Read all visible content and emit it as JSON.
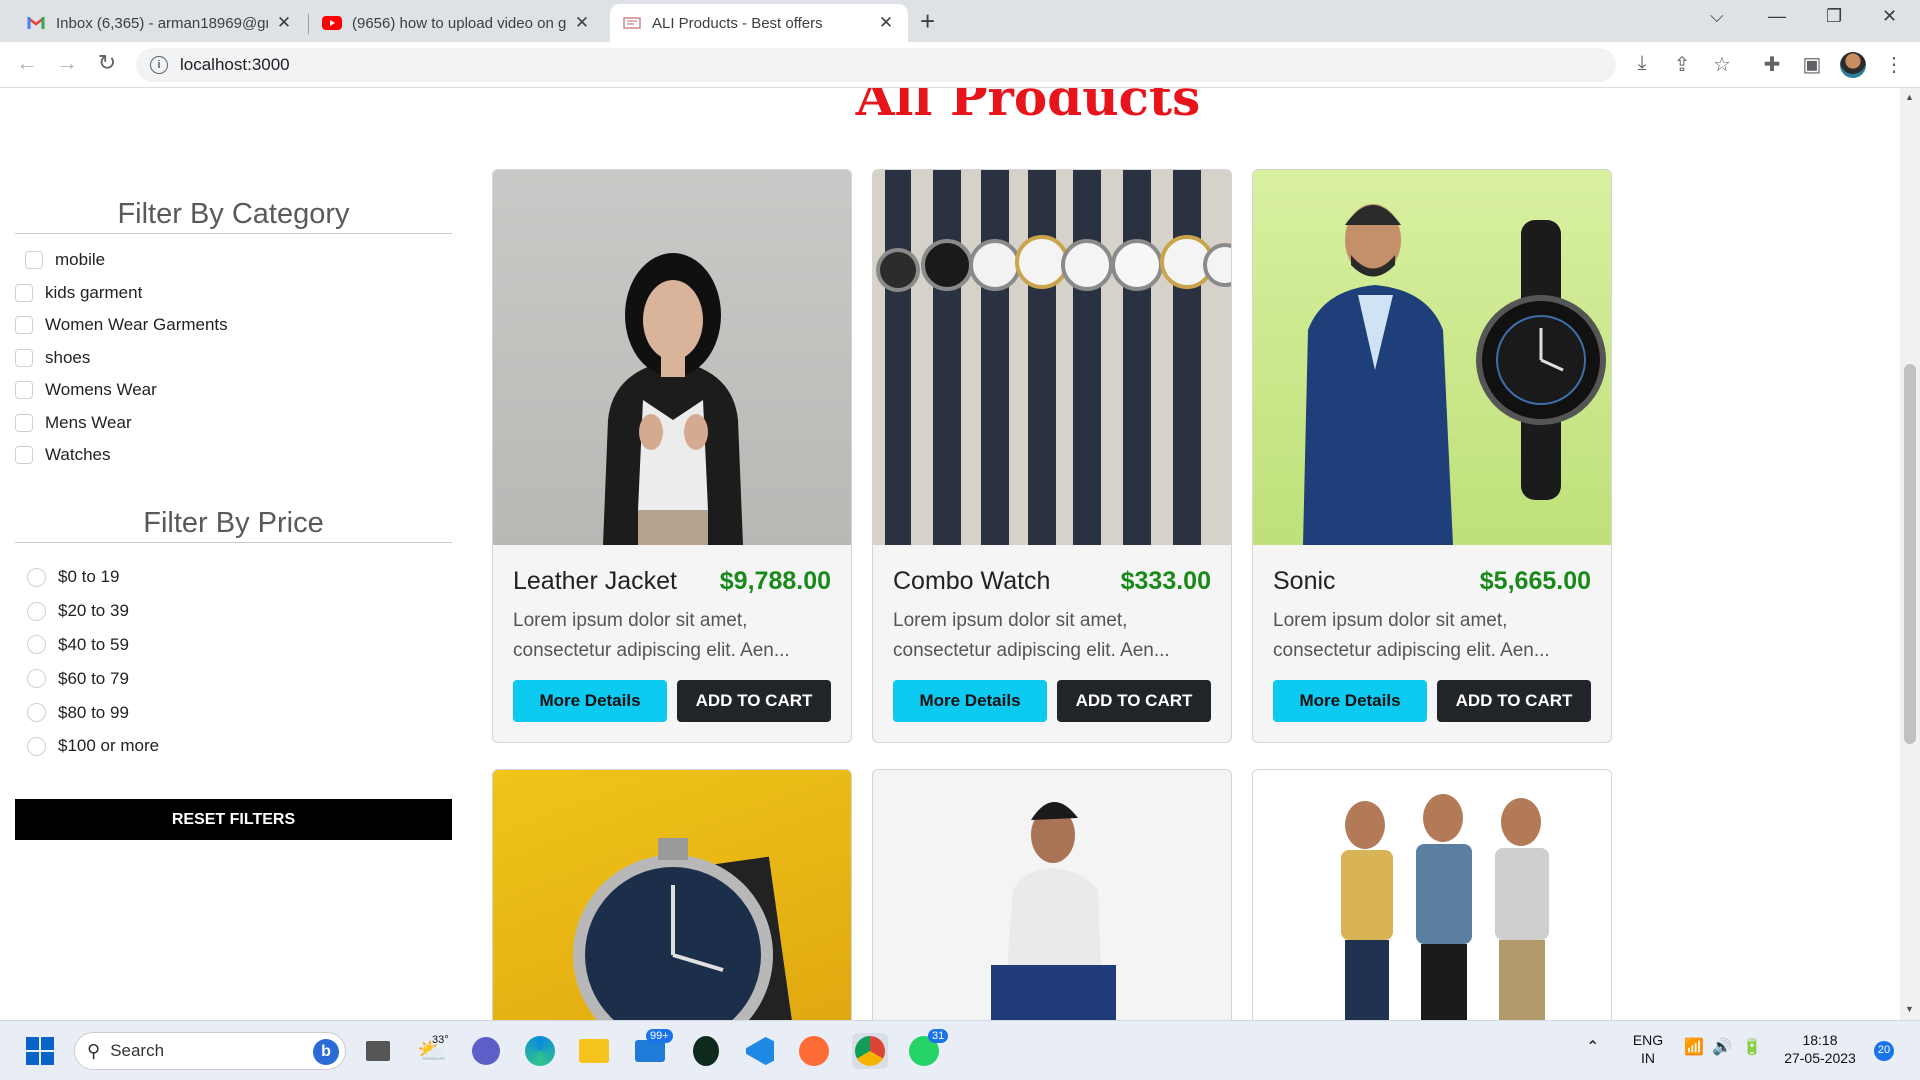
{
  "browser": {
    "tabs": [
      {
        "title": "Inbox (6,365) - arman18969@gm",
        "icon": "gmail-icon",
        "active": false
      },
      {
        "title": "(9656) how to upload video on g",
        "icon": "youtube-icon",
        "active": false
      },
      {
        "title": "ALI Products - Best offers",
        "icon": "site-icon",
        "active": true
      }
    ],
    "url": "localhost:3000"
  },
  "page": {
    "title": "All Products",
    "category_filter": {
      "heading": "Filter By Category",
      "options": [
        "mobile",
        "kids garment",
        "Women Wear Garments",
        "shoes",
        "Womens Wear",
        "Mens Wear",
        "Watches"
      ]
    },
    "price_filter": {
      "heading": "Filter By Price",
      "options": [
        "$0 to 19",
        "$20 to 39",
        "$40 to 59",
        "$60 to 79",
        "$80 to 99",
        "$100 or more"
      ]
    },
    "reset_label": "RESET FILTERS",
    "products": [
      {
        "name": "Leather Jacket",
        "price": "$9,788.00",
        "desc": "Lorem ipsum dolor sit amet, consectetur adipiscing elit. Aen...",
        "more": "More Details",
        "cart": "ADD TO CART"
      },
      {
        "name": "Combo Watch",
        "price": "$333.00",
        "desc": "Lorem ipsum dolor sit amet, consectetur adipiscing elit. Aen...",
        "more": "More Details",
        "cart": "ADD TO CART"
      },
      {
        "name": "Sonic",
        "price": "$5,665.00",
        "desc": "Lorem ipsum dolor sit amet, consectetur adipiscing elit. Aen...",
        "more": "More Details",
        "cart": "ADD TO CART"
      }
    ],
    "colors": {
      "title": "#e8141b",
      "price": "#198a19",
      "more_button": "#0dcaf0",
      "cart_button": "#212529"
    }
  },
  "taskbar": {
    "search_placeholder": "Search",
    "weather": "33°",
    "mail_badge": "99+",
    "whatsapp_badge": "31",
    "lang": "ENG",
    "region": "IN",
    "time": "18:18",
    "date": "27-05-2023",
    "notif_count": "20"
  }
}
